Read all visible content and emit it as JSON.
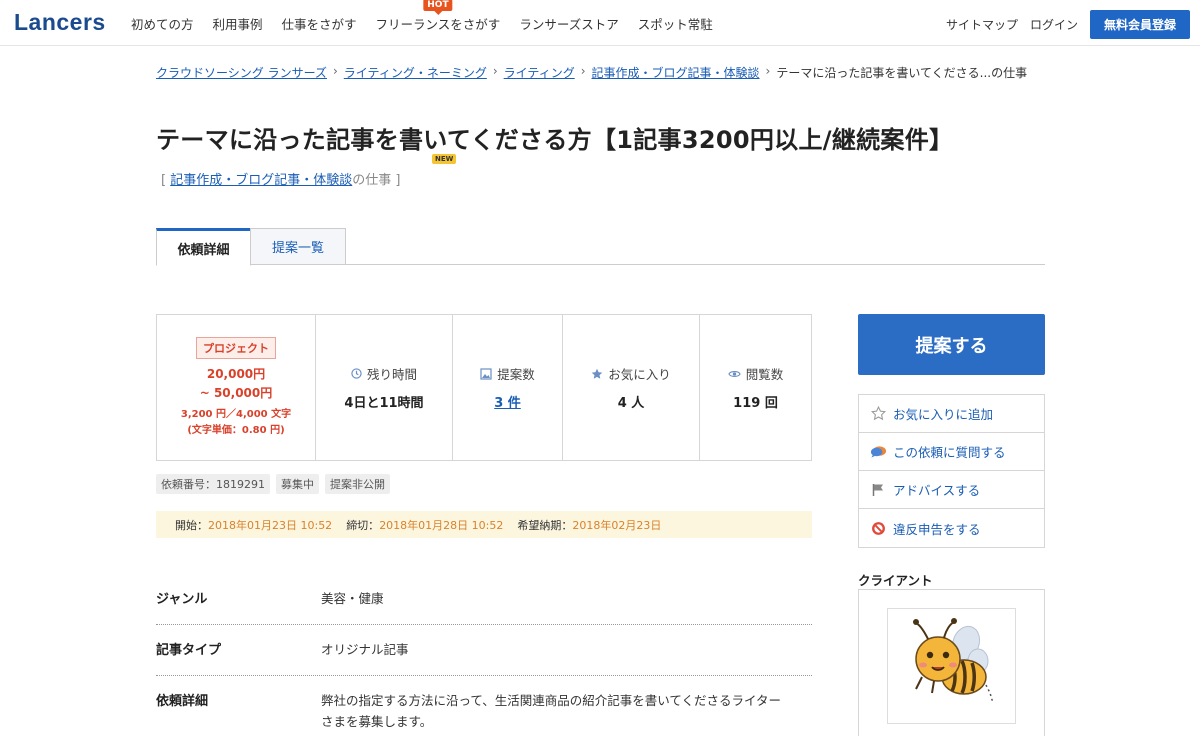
{
  "header": {
    "logo": "Lancers",
    "nav": [
      "初めての方",
      "利用事例",
      "仕事をさがす",
      "フリーランスをさがす",
      "ランサーズストア",
      "スポット常駐"
    ],
    "hot_badge": "HOT",
    "sitemap": "サイトマップ",
    "login": "ログイン",
    "signup": "無料会員登録"
  },
  "breadcrumb": {
    "items": [
      "クラウドソーシング ランサーズ",
      "ライティング・ネーミング",
      "ライティング",
      "記事作成・ブログ記事・体験談"
    ],
    "separator": "›",
    "current": "テーマに沿った記事を書いてくださる...の仕事"
  },
  "title": "テーマに沿った記事を書いてくださる方【1記事3200円以上/継続案件】",
  "new_badge": "NEW",
  "category": {
    "open": "[",
    "link": "記事作成・ブログ記事・体験談",
    "suffix": "の仕事",
    "close": "]"
  },
  "tabs": {
    "details": "依頼詳細",
    "proposals": "提案一覧"
  },
  "stats": {
    "project_badge": "プロジェクト",
    "price_min": "20,000円",
    "price_max": "~ 50,000円",
    "price_per": "3,200 円／4,000 文字",
    "unit_price": "(文字単価：0.80 円)",
    "remaining_label": "残り時間",
    "remaining_value": "4日と11時間",
    "proposals_label": "提案数",
    "proposals_value": "3 件",
    "favorites_label": "お気に入り",
    "favorites_value": "4 人",
    "views_label": "閲覧数",
    "views_value": "119 回"
  },
  "tags": [
    "依頼番号：1819291",
    "募集中",
    "提案非公開"
  ],
  "dates": {
    "start_label": "開始：",
    "start": "2018年01月23日 10:52",
    "deadline_label": "締切：",
    "deadline": "2018年01月28日 10:52",
    "delivery_label": "希望納期：",
    "delivery": "2018年02月23日"
  },
  "details": [
    {
      "label": "ジャンル",
      "value": "美容・健康"
    },
    {
      "label": "記事タイプ",
      "value": "オリジナル記事"
    },
    {
      "label": "依頼詳細",
      "value": "弊社の指定する方法に沿って、生活関連商品の紹介記事を書いてくださるライターさまを募集します。"
    }
  ],
  "sidebar": {
    "propose": "提案する",
    "actions": [
      "お気に入りに追加",
      "この依頼に質問する",
      "アドバイスする",
      "違反申告をする"
    ],
    "client_heading": "クライアント"
  },
  "colors": {
    "brand": "#1a4b8f",
    "primary_button": "#2b6cc4",
    "price_red": "#d9412b",
    "date_orange": "#d9822b"
  }
}
